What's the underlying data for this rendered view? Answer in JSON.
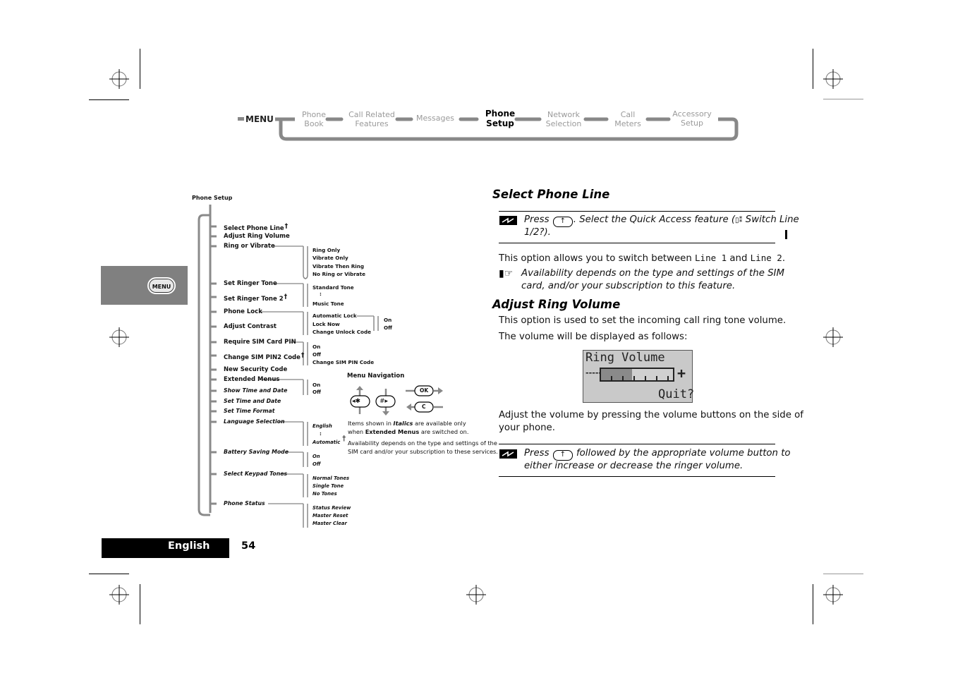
{
  "nav": {
    "menu_label": "MENU",
    "items": [
      {
        "line1": "Phone",
        "line2": "Book",
        "active": false
      },
      {
        "line1": "Call Related",
        "line2": "Features",
        "active": false
      },
      {
        "line1": "Messages",
        "line2": "",
        "active": false
      },
      {
        "line1": "Phone",
        "line2": "Setup",
        "active": true
      },
      {
        "line1": "Network",
        "line2": "Selection",
        "active": false
      },
      {
        "line1": "Call",
        "line2": "Meters",
        "active": false
      },
      {
        "line1": "Accessory",
        "line2": "Setup",
        "active": false
      }
    ]
  },
  "side_tab": {
    "menu_button_label": "MENU"
  },
  "tree": {
    "root": "Phone Setup",
    "items": [
      {
        "label": "Select Phone Line",
        "dagger": "†",
        "italic": false
      },
      {
        "label": "Adjust Ring Volume",
        "italic": false
      },
      {
        "label": "Ring or Vibrate",
        "italic": false,
        "children": [
          "Ring Only",
          "Vibrate Only",
          "Vibrate Then Ring",
          "No Ring or Vibrate"
        ]
      },
      {
        "label": "Set Ringer Tone",
        "italic": false,
        "children": [
          "Standard Tone",
          ":",
          "Music Tone"
        ]
      },
      {
        "label": "Set Ringer Tone 2",
        "dagger": "†",
        "italic": false
      },
      {
        "label": "Phone Lock",
        "italic": false,
        "children": [
          "Automatic Lock",
          "Lock Now",
          "Change Unlock Code"
        ],
        "grandchildren": [
          "On",
          "Off"
        ]
      },
      {
        "label": "Adjust Contrast",
        "italic": false
      },
      {
        "label": "Require SIM Card PIN",
        "italic": false,
        "children": [
          "On",
          "Off",
          "Change SIM PIN Code"
        ]
      },
      {
        "label": "Change SIM PIN2 Code",
        "dagger": "†",
        "italic": false
      },
      {
        "label": "New Security Code",
        "italic": false
      },
      {
        "label": "Extended Menus",
        "italic": false,
        "children": [
          "On",
          "Off"
        ]
      },
      {
        "label": "Show Time and Date",
        "italic": true
      },
      {
        "label": "Set Time and Date",
        "italic": true
      },
      {
        "label": "Set Time Format",
        "italic": true
      },
      {
        "label": "Language Selection",
        "italic": true,
        "children": [
          "English",
          ":",
          "Automatic"
        ]
      },
      {
        "label": "Battery Saving Mode",
        "italic": true,
        "children": [
          "On",
          "Off"
        ]
      },
      {
        "label": "Select Keypad Tones",
        "italic": true,
        "children": [
          "Normal Tones",
          "Single Tone",
          "No Tones"
        ]
      },
      {
        "label": "Phone Status",
        "italic": true,
        "children": [
          "Status Review",
          "Master Reset",
          "Master Clear"
        ]
      }
    ]
  },
  "legend": {
    "title": "Menu Navigation",
    "keys": {
      "left": "◂✱",
      "right": "#▸",
      "ok": "OK",
      "clear": "C"
    },
    "italics_note_pre": "Items shown in ",
    "italics_word": "Italics",
    "italics_note_post": " are available only",
    "ext_note_pre": "when ",
    "ext_word": "Extended Menus",
    "ext_note_post": " are switched on.",
    "dagger": "†",
    "dagger_note_1": "Availability depends on the type and settings of the",
    "dagger_note_2": "SIM card and/or your subscription to these services."
  },
  "content": {
    "section1": {
      "heading": "Select Phone Line",
      "shortcut_press": "Press",
      "shortcut_key": "↑",
      "shortcut_rest": ". Select the Quick Access feature (",
      "shortcut_feature": "Switch Line",
      "shortcut_line2": "1/2?).",
      "body_pre": "This option allows you to switch between ",
      "line1": "Line 1",
      "body_mid": " and ",
      "line2": "Line 2",
      "body_post": ".",
      "note_1": "Availability depends on the type and settings of the SIM",
      "note_2": "card, and/or your subscription to this feature."
    },
    "section2": {
      "heading": "Adjust Ring Volume",
      "body1": "This option is used to set the incoming call ring tone volume.",
      "body2": "The volume will be displayed as follows:",
      "lcd": {
        "title": "Ring Volume",
        "minus": "-----",
        "plus": "+",
        "quit": "Quit?",
        "level_fraction": 0.43
      },
      "body3_1": "Adjust the volume by pressing the volume buttons on the side of",
      "body3_2": "your phone.",
      "shortcut_press": "Press",
      "shortcut_key": "↑",
      "shortcut_rest": " followed by the appropriate volume button to",
      "shortcut_line2": "either increase or decrease the ringer volume."
    }
  },
  "footer": {
    "language": "English",
    "page": "54"
  }
}
